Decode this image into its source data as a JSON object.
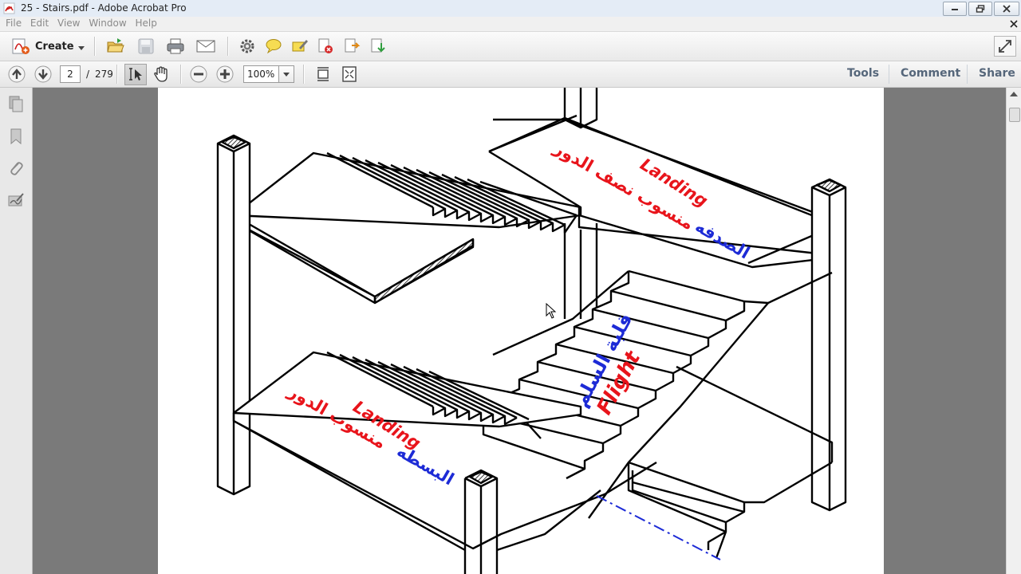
{
  "window": {
    "title": "25 - Stairs.pdf - Adobe Acrobat Pro"
  },
  "menu": {
    "items": [
      "File",
      "Edit",
      "View",
      "Window",
      "Help"
    ]
  },
  "toolbar": {
    "create_label": "Create"
  },
  "nav": {
    "page_current": "2",
    "page_separator": "/",
    "page_total": "279",
    "zoom": "100%"
  },
  "right_tabs": {
    "tools": "Tools",
    "comment": "Comment",
    "share": "Share"
  },
  "drawing": {
    "upper_landing_en": "Landing",
    "upper_landing_ar_red": "منسوب نصف الدور",
    "upper_landing_ar_blue": "الصدفه",
    "lower_landing_en": "Landing",
    "lower_landing_ar_red": "منسوب الدور",
    "lower_landing_ar_blue": "البسطه",
    "flight_en": "Flight",
    "flight_ar": "قلبة السلم"
  },
  "colors": {
    "red": "#e8141b",
    "blue": "#1d2bd6",
    "docbg": "#7a7a7a",
    "tabtext": "#55667a"
  }
}
